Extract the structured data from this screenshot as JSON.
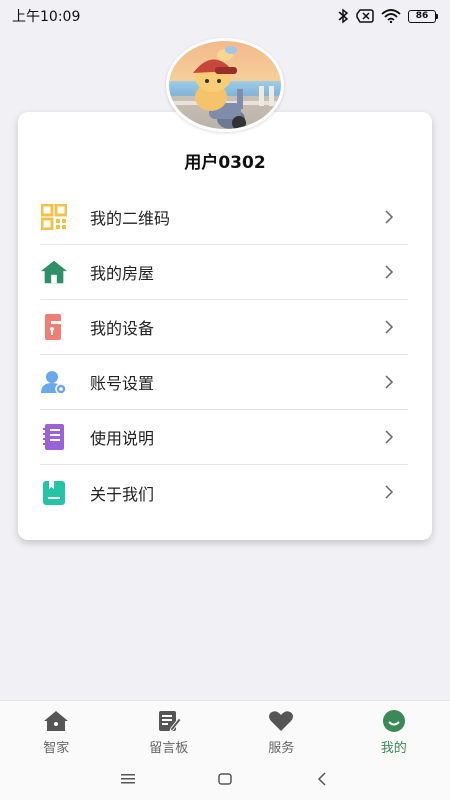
{
  "status": {
    "time": "上午10:09",
    "battery": "86"
  },
  "profile": {
    "username": "用户0302"
  },
  "menu": [
    {
      "label": "我的二维码",
      "icon": "qr-code-icon",
      "color": "#f3c24b"
    },
    {
      "label": "我的房屋",
      "icon": "house-icon",
      "color": "#2e8f68"
    },
    {
      "label": "我的设备",
      "icon": "door-lock-icon",
      "color": "#f07e74"
    },
    {
      "label": "账号设置",
      "icon": "user-settings-icon",
      "color": "#6aa8ee"
    },
    {
      "label": "使用说明",
      "icon": "notebook-icon",
      "color": "#9b61d9"
    },
    {
      "label": "关于我们",
      "icon": "about-icon",
      "color": "#26c4a6"
    }
  ],
  "tabs": [
    {
      "label": "智家",
      "icon": "home-icon"
    },
    {
      "label": "留言板",
      "icon": "message-board-icon"
    },
    {
      "label": "服务",
      "icon": "heart-icon"
    },
    {
      "label": "我的",
      "icon": "smile-face-icon",
      "active": true
    }
  ],
  "colors": {
    "accent": "#3a8a57",
    "background": "#f1f1f5"
  }
}
